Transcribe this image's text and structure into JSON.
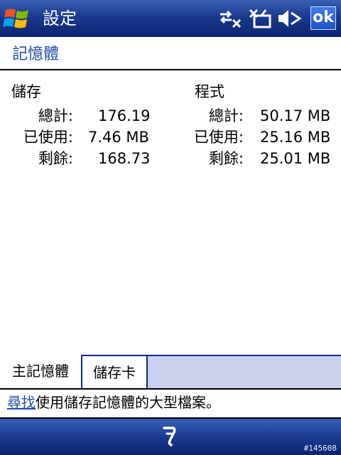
{
  "titlebar": {
    "app_title": "設定",
    "ok_label": "ok",
    "icons": [
      "windows-start-icon",
      "network-sync-icon",
      "no-signal-phone-icon",
      "speaker-muted-icon"
    ]
  },
  "page": {
    "title": "記憶體"
  },
  "storage": {
    "heading": "儲存",
    "rows": [
      {
        "label": "總計:",
        "value": "176.19"
      },
      {
        "label": "已使用:",
        "value": "7.46 MB"
      },
      {
        "label": "剩餘:",
        "value": "168.73"
      }
    ]
  },
  "program": {
    "heading": "程式",
    "rows": [
      {
        "label": "總計:",
        "value": "50.17 MB"
      },
      {
        "label": "已使用:",
        "value": "25.16 MB"
      },
      {
        "label": "剩餘:",
        "value": "25.01 MB"
      }
    ]
  },
  "tabs": [
    {
      "label": "主記憶體",
      "active": true
    },
    {
      "label": "儲存卡",
      "active": false
    }
  ],
  "find": {
    "link": "尋找",
    "text": "使用儲存記憶體的大型檔案。"
  },
  "softkeys": {
    "input_icon": "input-panel-icon"
  },
  "watermark": "#145608",
  "colors": {
    "titlebar": "#1a3b8e",
    "link": "#1f4fa8",
    "tab_bg": "#cbd2f0",
    "ok_button": "#2a63d4"
  }
}
